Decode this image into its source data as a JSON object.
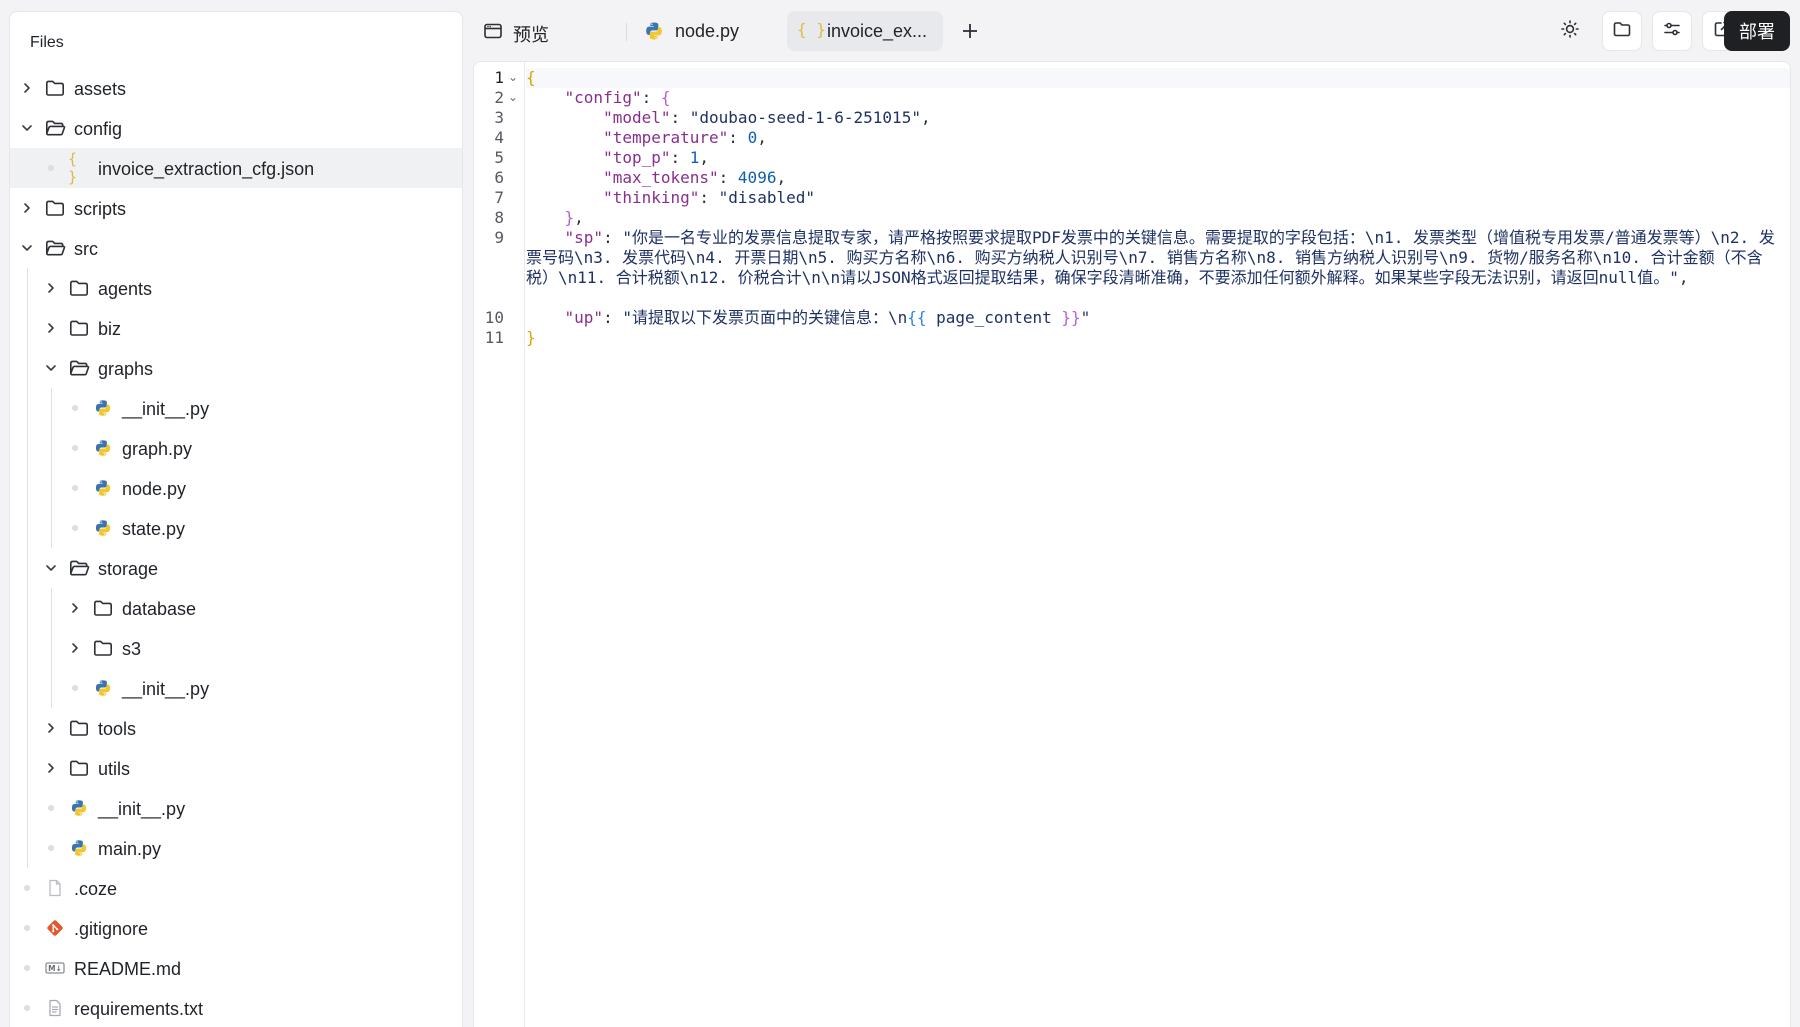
{
  "sidebar": {
    "title": "Files",
    "items": [
      {
        "label": "assets",
        "type": "folder",
        "expanded": false
      },
      {
        "label": "config",
        "type": "folder",
        "expanded": true
      },
      {
        "label": "invoice_extraction_cfg.json",
        "type": "json",
        "selected": true
      },
      {
        "label": "scripts",
        "type": "folder",
        "expanded": false
      },
      {
        "label": "src",
        "type": "folder",
        "expanded": true
      },
      {
        "label": "agents",
        "type": "folder",
        "expanded": false
      },
      {
        "label": "biz",
        "type": "folder",
        "expanded": false
      },
      {
        "label": "graphs",
        "type": "folder",
        "expanded": true
      },
      {
        "label": "__init__.py",
        "type": "python"
      },
      {
        "label": "graph.py",
        "type": "python"
      },
      {
        "label": "node.py",
        "type": "python"
      },
      {
        "label": "state.py",
        "type": "python"
      },
      {
        "label": "storage",
        "type": "folder",
        "expanded": true
      },
      {
        "label": "database",
        "type": "folder",
        "expanded": false
      },
      {
        "label": "s3",
        "type": "folder",
        "expanded": false
      },
      {
        "label": "__init__.py",
        "type": "python"
      },
      {
        "label": "tools",
        "type": "folder",
        "expanded": false
      },
      {
        "label": "utils",
        "type": "folder",
        "expanded": false
      },
      {
        "label": "__init__.py",
        "type": "python"
      },
      {
        "label": "main.py",
        "type": "python"
      },
      {
        "label": ".coze",
        "type": "file"
      },
      {
        "label": ".gitignore",
        "type": "git"
      },
      {
        "label": "README.md",
        "type": "markdown"
      },
      {
        "label": "requirements.txt",
        "type": "text"
      }
    ]
  },
  "tabs": [
    {
      "label": "预览",
      "icon": "browser-icon"
    },
    {
      "label": "node.py",
      "icon": "python-icon"
    },
    {
      "label": "invoice_ex...",
      "icon": "json-icon",
      "active": true
    }
  ],
  "toolbar": {
    "deploy_label": "部署",
    "icons": [
      "sun-icon",
      "folder-icon",
      "sliders-icon",
      "external-link-icon"
    ]
  },
  "editor": {
    "line_numbers": [
      "1",
      "2",
      "3",
      "4",
      "5",
      "6",
      "7",
      "8",
      "9",
      "10",
      "11"
    ],
    "lines": {
      "l1": "{",
      "l2_key": "\"config\"",
      "l2_brace": "{",
      "l3_key": "\"model\"",
      "l3_val": "\"doubao-seed-1-6-251015\"",
      "l4_key": "\"temperature\"",
      "l4_val": "0",
      "l5_key": "\"top_p\"",
      "l5_val": "1",
      "l6_key": "\"max_tokens\"",
      "l6_val": "4096",
      "l7_key": "\"thinking\"",
      "l7_val": "\"disabled\"",
      "l8": "}",
      "l9_key": "\"sp\"",
      "l9_val": "\"你是一名专业的发票信息提取专家，请严格按照要求提取PDF发票中的关键信息。需要提取的字段包括：\\n1. 发票类型（增值税专用发票/普通发票等）\\n2. 发票号码\\n3. 发票代码\\n4. 开票日期\\n5. 购买方名称\\n6. 购买方纳税人识别号\\n7. 销售方名称\\n8. 销售方纳税人识别号\\n9. 货物/服务名称\\n10. 合计金额（不含税）\\n11. 合计税额\\n12. 价税合计\\n\\n请以JSON格式返回提取结果，确保字段清晰准确，不要添加任何额外解释。如果某些字段无法识别，请返回null值。\"",
      "l10_key": "\"up\"",
      "l10_val_a": "\"请提取以下发票页面中的关键信息：\\n",
      "l10_open": "{{",
      "l10_var": " page_content ",
      "l10_close": "}}",
      "l10_end": "\"",
      "l11": "}"
    }
  }
}
